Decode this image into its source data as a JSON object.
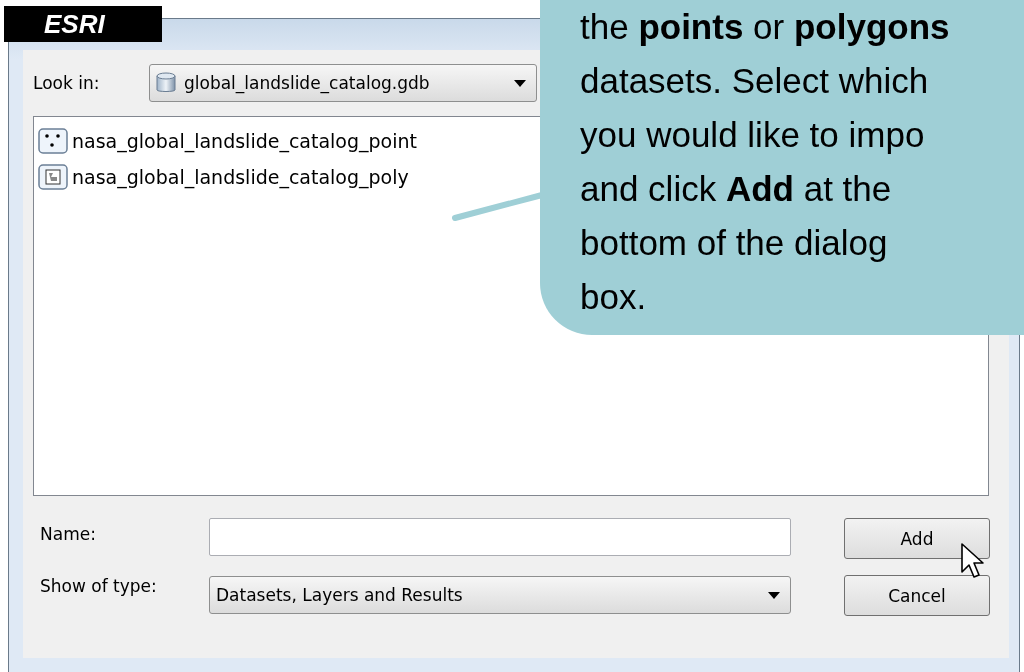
{
  "logo": "ESRI",
  "look_in": {
    "label": "Look in:",
    "value": "global_landslide_catalog.gdb"
  },
  "items": [
    {
      "name": "nasa_global_landslide_catalog_point",
      "kind": "point"
    },
    {
      "name": "nasa_global_landslide_catalog_poly",
      "kind": "polygon"
    }
  ],
  "name_field": {
    "label": "Name:"
  },
  "type_field": {
    "label": "Show of type:",
    "value": "Datasets, Layers and Results"
  },
  "buttons": [
    "Add",
    "Cancel"
  ],
  "callout": {
    "lines": [
      "the **points** or **polygons**",
      "datasets. Select which",
      "you would like to impo",
      "and click **Add** at the",
      "bottom of the dialog",
      "box."
    ]
  }
}
